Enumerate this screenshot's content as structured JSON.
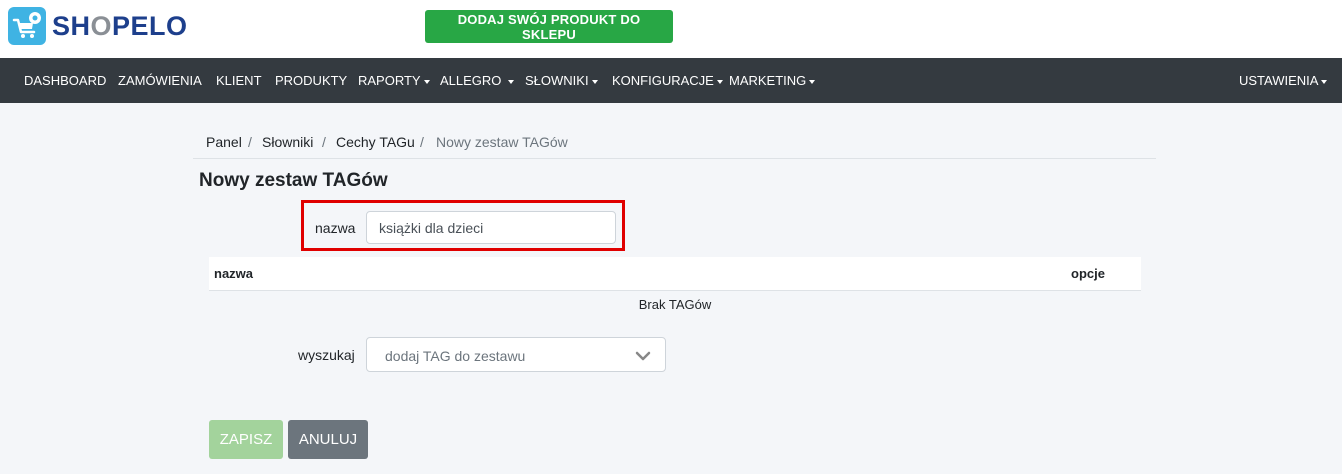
{
  "brand": {
    "prefix": "SH",
    "o": "O",
    "suffix": "PELO"
  },
  "header": {
    "promo_label": "DODAJ SWÓJ PRODUKT DO SKLEPU"
  },
  "nav": {
    "items": [
      {
        "label": "DASHBOARD"
      },
      {
        "label": "ZAMÓWIENIA"
      },
      {
        "label": "KLIENT"
      },
      {
        "label": "PRODUKTY"
      },
      {
        "label": "RAPORTY"
      },
      {
        "label": "ALLEGRO"
      },
      {
        "label": "SŁOWNIKI"
      },
      {
        "label": "KONFIGURACJE"
      },
      {
        "label": "MARKETING"
      }
    ],
    "settings": "USTAWIENIA"
  },
  "breadcrumb": {
    "items": [
      "Panel",
      "Słowniki",
      "Cechy TAGu"
    ],
    "current": "Nowy zestaw TAGów",
    "separator": "/"
  },
  "page": {
    "title": "Nowy zestaw TAGów"
  },
  "form": {
    "name_label": "nazwa",
    "name_value": "książki dla dzieci",
    "table": {
      "col_name": "nazwa",
      "col_options": "opcje",
      "empty": "Brak TAGów"
    },
    "search_label": "wyszukaj",
    "search_placeholder": "dodaj TAG do zestawu",
    "save": "ZAPISZ",
    "cancel": "ANULUJ"
  },
  "colors": {
    "accent_green": "#28a745",
    "navbar": "#343a40",
    "highlight": "#e00000",
    "brand_blue": "#1d3f8c",
    "logo_badge": "#3fb3e3"
  }
}
